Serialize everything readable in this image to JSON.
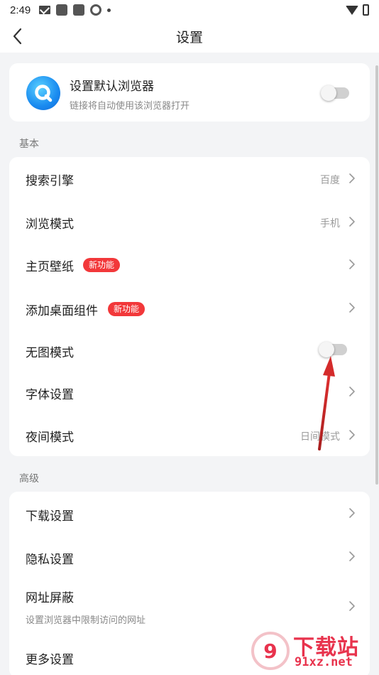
{
  "status_bar": {
    "time": "2:49"
  },
  "header": {
    "title": "设置"
  },
  "default_browser": {
    "title": "设置默认浏览器",
    "subtitle": "链接将自动使用该浏览器打开",
    "enabled": false
  },
  "sections": {
    "basic": {
      "label": "基本",
      "items": [
        {
          "label": "搜索引擎",
          "value": "百度"
        },
        {
          "label": "浏览模式",
          "value": "手机"
        },
        {
          "label": "主页壁纸",
          "badge": "新功能"
        },
        {
          "label": "添加桌面组件",
          "badge": "新功能"
        },
        {
          "label": "无图模式",
          "enabled": false
        },
        {
          "label": "字体设置"
        },
        {
          "label": "夜间模式",
          "value": "日间模式"
        }
      ]
    },
    "advanced": {
      "label": "高级",
      "items": [
        {
          "label": "下载设置"
        },
        {
          "label": "隐私设置"
        },
        {
          "label": "网址屏蔽",
          "subtitle": "设置浏览器中限制访问的网址"
        },
        {
          "label": "更多设置"
        }
      ]
    }
  },
  "watermark": {
    "text": "下载站",
    "url": "91xz.net"
  },
  "colors": {
    "badge": "#f2383a",
    "annotation_arrow": "#d42b2b",
    "background": "#f3f4f6"
  }
}
